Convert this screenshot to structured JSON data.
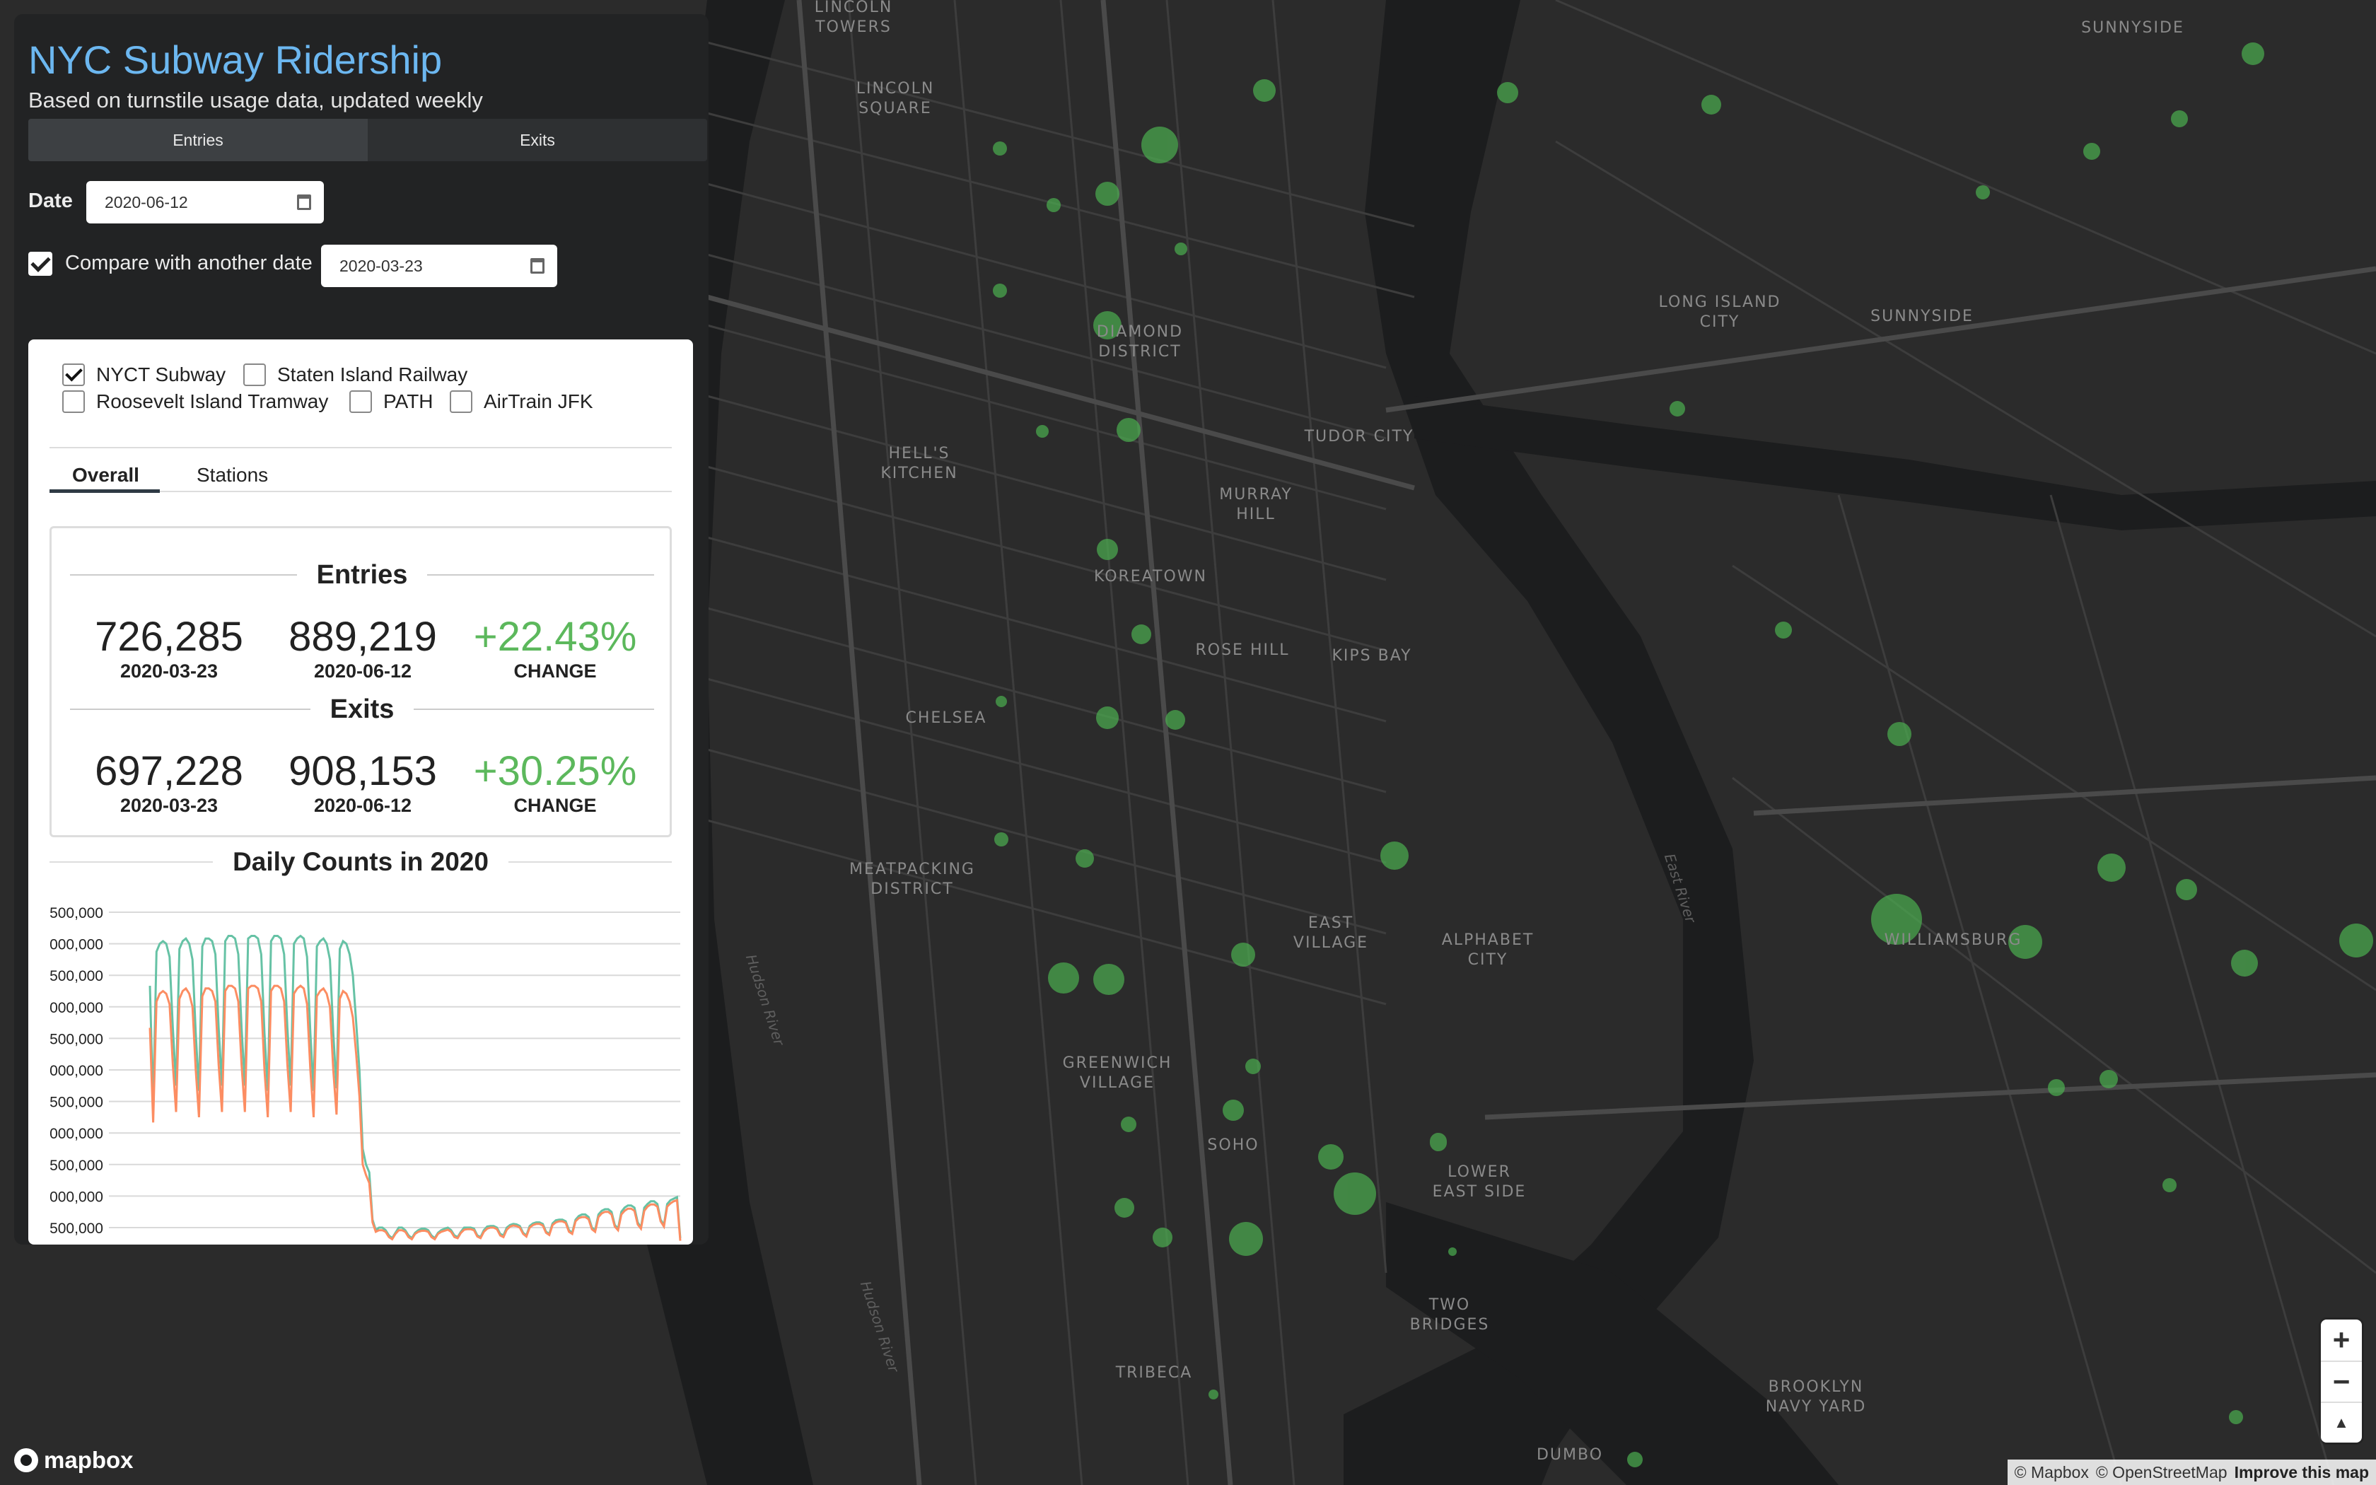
{
  "app": {
    "title": "NYC Subway Ridership",
    "subtitle": "Based on turnstile usage data, updated weekly"
  },
  "view_tabs": [
    {
      "label": "Entries",
      "active": true
    },
    {
      "label": "Exits",
      "active": false
    }
  ],
  "date_filter": {
    "label": "Date",
    "value": "2020-06-12"
  },
  "compare": {
    "label": "Compare with another date",
    "checked": true,
    "value": "2020-03-23"
  },
  "systems": [
    {
      "label": "NYCT Subway",
      "checked": true
    },
    {
      "label": "Staten Island Railway",
      "checked": false
    },
    {
      "label": "Roosevelt Island Tramway",
      "checked": false
    },
    {
      "label": "PATH",
      "checked": false
    },
    {
      "label": "AirTrain JFK",
      "checked": false
    }
  ],
  "card_tabs": [
    {
      "label": "Overall",
      "active": true
    },
    {
      "label": "Stations",
      "active": false
    }
  ],
  "stats": {
    "entries": {
      "heading": "Entries",
      "compare_value": "726,285",
      "compare_date": "2020-03-23",
      "current_value": "889,219",
      "current_date": "2020-06-12",
      "change": "+22.43%",
      "change_label": "CHANGE"
    },
    "exits": {
      "heading": "Exits",
      "compare_value": "697,228",
      "compare_date": "2020-03-23",
      "current_value": "908,153",
      "current_date": "2020-06-12",
      "change": "+30.25%",
      "change_label": "CHANGE"
    }
  },
  "chart_data": {
    "type": "line",
    "title": "Daily Counts in 2020",
    "ytick_labels": [
      "500,000",
      "000,000",
      "500,000",
      "000,000",
      "500,000",
      "000,000",
      "500,000",
      "000,000",
      "500,000",
      "000,000",
      "500,000"
    ],
    "series": [
      {
        "color": "#66c2a5",
        "values": [
          4.9,
          2.6,
          5.55,
          5.7,
          5.75,
          5.7,
          5.45,
          4.1,
          3.0,
          5.6,
          5.75,
          5.8,
          5.7,
          5.4,
          4.0,
          2.9,
          5.65,
          5.8,
          5.8,
          5.75,
          5.5,
          4.1,
          3.0,
          5.75,
          5.85,
          5.85,
          5.8,
          5.5,
          4.1,
          3.0,
          5.8,
          5.85,
          5.85,
          5.8,
          5.5,
          4.0,
          2.9,
          5.75,
          5.85,
          5.85,
          5.8,
          5.5,
          4.1,
          3.0,
          5.7,
          5.8,
          5.85,
          5.8,
          5.45,
          4.0,
          2.9,
          5.65,
          5.75,
          5.8,
          5.7,
          5.4,
          4.0,
          2.95,
          5.6,
          5.75,
          5.7,
          5.5,
          5.1,
          4.2,
          3.3,
          1.8,
          1.5,
          1.35,
          0.45,
          0.25,
          0.3,
          0.3,
          0.25,
          0.15,
          0.1,
          0.2,
          0.3,
          0.3,
          0.25,
          0.15,
          0.1,
          0.2,
          0.25,
          0.28,
          0.28,
          0.25,
          0.15,
          0.1,
          0.2,
          0.25,
          0.28,
          0.3,
          0.25,
          0.15,
          0.12,
          0.22,
          0.3,
          0.3,
          0.3,
          0.28,
          0.15,
          0.12,
          0.25,
          0.32,
          0.33,
          0.33,
          0.3,
          0.18,
          0.15,
          0.3,
          0.35,
          0.37,
          0.36,
          0.33,
          0.2,
          0.15,
          0.33,
          0.38,
          0.4,
          0.4,
          0.37,
          0.22,
          0.18,
          0.38,
          0.44,
          0.45,
          0.45,
          0.42,
          0.25,
          0.2,
          0.45,
          0.52,
          0.55,
          0.55,
          0.5,
          0.3,
          0.25,
          0.55,
          0.62,
          0.65,
          0.65,
          0.6,
          0.35,
          0.28,
          0.6,
          0.68,
          0.72,
          0.72,
          0.68,
          0.4,
          0.3,
          0.68,
          0.75,
          0.8,
          0.8,
          0.75,
          0.45,
          0.35,
          0.75,
          0.82,
          0.85,
          0.88,
          0.1
        ]
      },
      {
        "color": "#fc8d62",
        "values": [
          4.1,
          2.3,
          4.6,
          4.75,
          4.8,
          4.75,
          4.55,
          3.4,
          2.5,
          4.65,
          4.8,
          4.85,
          4.75,
          4.5,
          3.3,
          2.4,
          4.7,
          4.85,
          4.85,
          4.8,
          4.6,
          3.4,
          2.5,
          4.8,
          4.9,
          4.9,
          4.85,
          4.6,
          3.4,
          2.5,
          4.85,
          4.9,
          4.9,
          4.85,
          4.6,
          3.3,
          2.4,
          4.8,
          4.9,
          4.9,
          4.85,
          4.6,
          3.4,
          2.5,
          4.75,
          4.85,
          4.9,
          4.85,
          4.55,
          3.3,
          2.4,
          4.7,
          4.8,
          4.85,
          4.75,
          4.5,
          3.3,
          2.45,
          4.65,
          4.8,
          4.75,
          4.6,
          4.3,
          3.6,
          2.8,
          1.5,
          1.3,
          1.15,
          0.4,
          0.22,
          0.25,
          0.25,
          0.22,
          0.12,
          0.08,
          0.18,
          0.25,
          0.25,
          0.22,
          0.12,
          0.08,
          0.18,
          0.22,
          0.24,
          0.24,
          0.22,
          0.12,
          0.08,
          0.18,
          0.22,
          0.24,
          0.26,
          0.22,
          0.12,
          0.1,
          0.2,
          0.26,
          0.27,
          0.27,
          0.25,
          0.13,
          0.1,
          0.22,
          0.28,
          0.3,
          0.3,
          0.27,
          0.15,
          0.12,
          0.26,
          0.32,
          0.34,
          0.33,
          0.3,
          0.18,
          0.13,
          0.3,
          0.35,
          0.37,
          0.37,
          0.34,
          0.2,
          0.16,
          0.35,
          0.4,
          0.42,
          0.42,
          0.39,
          0.22,
          0.18,
          0.42,
          0.48,
          0.5,
          0.5,
          0.46,
          0.27,
          0.22,
          0.5,
          0.57,
          0.6,
          0.6,
          0.55,
          0.32,
          0.25,
          0.55,
          0.62,
          0.66,
          0.66,
          0.62,
          0.36,
          0.28,
          0.62,
          0.7,
          0.74,
          0.74,
          0.7,
          0.42,
          0.32,
          0.7,
          0.76,
          0.8,
          0.82,
          0.05
        ]
      }
    ],
    "yrange": [
      0,
      6.3
    ],
    "grid": true
  },
  "map": {
    "labels": [
      {
        "text": "LINCOLN\nTOWERS"
      },
      {
        "text": "LINCOLN\nSQUARE"
      },
      {
        "text": "DIAMOND\nDISTRICT"
      },
      {
        "text": "HELL'S\nKITCHEN"
      },
      {
        "text": "TUDOR CITY"
      },
      {
        "text": "MURRAY\nHILL"
      },
      {
        "text": "KOREATOWN"
      },
      {
        "text": "ROSE HILL"
      },
      {
        "text": "KIPS BAY"
      },
      {
        "text": "CHELSEA"
      },
      {
        "text": "MEATPACKING\nDISTRICT"
      },
      {
        "text": "EAST\nVILLAGE"
      },
      {
        "text": "ALPHABET\nCITY"
      },
      {
        "text": "GREENWICH\nVILLAGE"
      },
      {
        "text": "SOHO"
      },
      {
        "text": "LOWER\nEAST SIDE"
      },
      {
        "text": "TWO\nBRIDGES"
      },
      {
        "text": "TRIBECA"
      },
      {
        "text": "DUMBO"
      },
      {
        "text": "BROOKLYN\nNAVY YARD"
      },
      {
        "text": "WILLIAMSBURG"
      },
      {
        "text": "LONG ISLAND\nCITY"
      },
      {
        "text": "SUNNYSIDE"
      },
      {
        "text": "SUNNYSIDE"
      }
    ],
    "water_labels": [
      {
        "text": "Hudson River"
      },
      {
        "text": "East River"
      },
      {
        "text": "Hudson River"
      }
    ]
  },
  "zoom": {
    "in_label": "+",
    "out_label": "−",
    "compass_label": "▲"
  },
  "attribution": {
    "mapbox": "© Mapbox",
    "osm": "© OpenStreetMap",
    "improve": "Improve this map"
  },
  "logo": {
    "text": "mapbox"
  }
}
